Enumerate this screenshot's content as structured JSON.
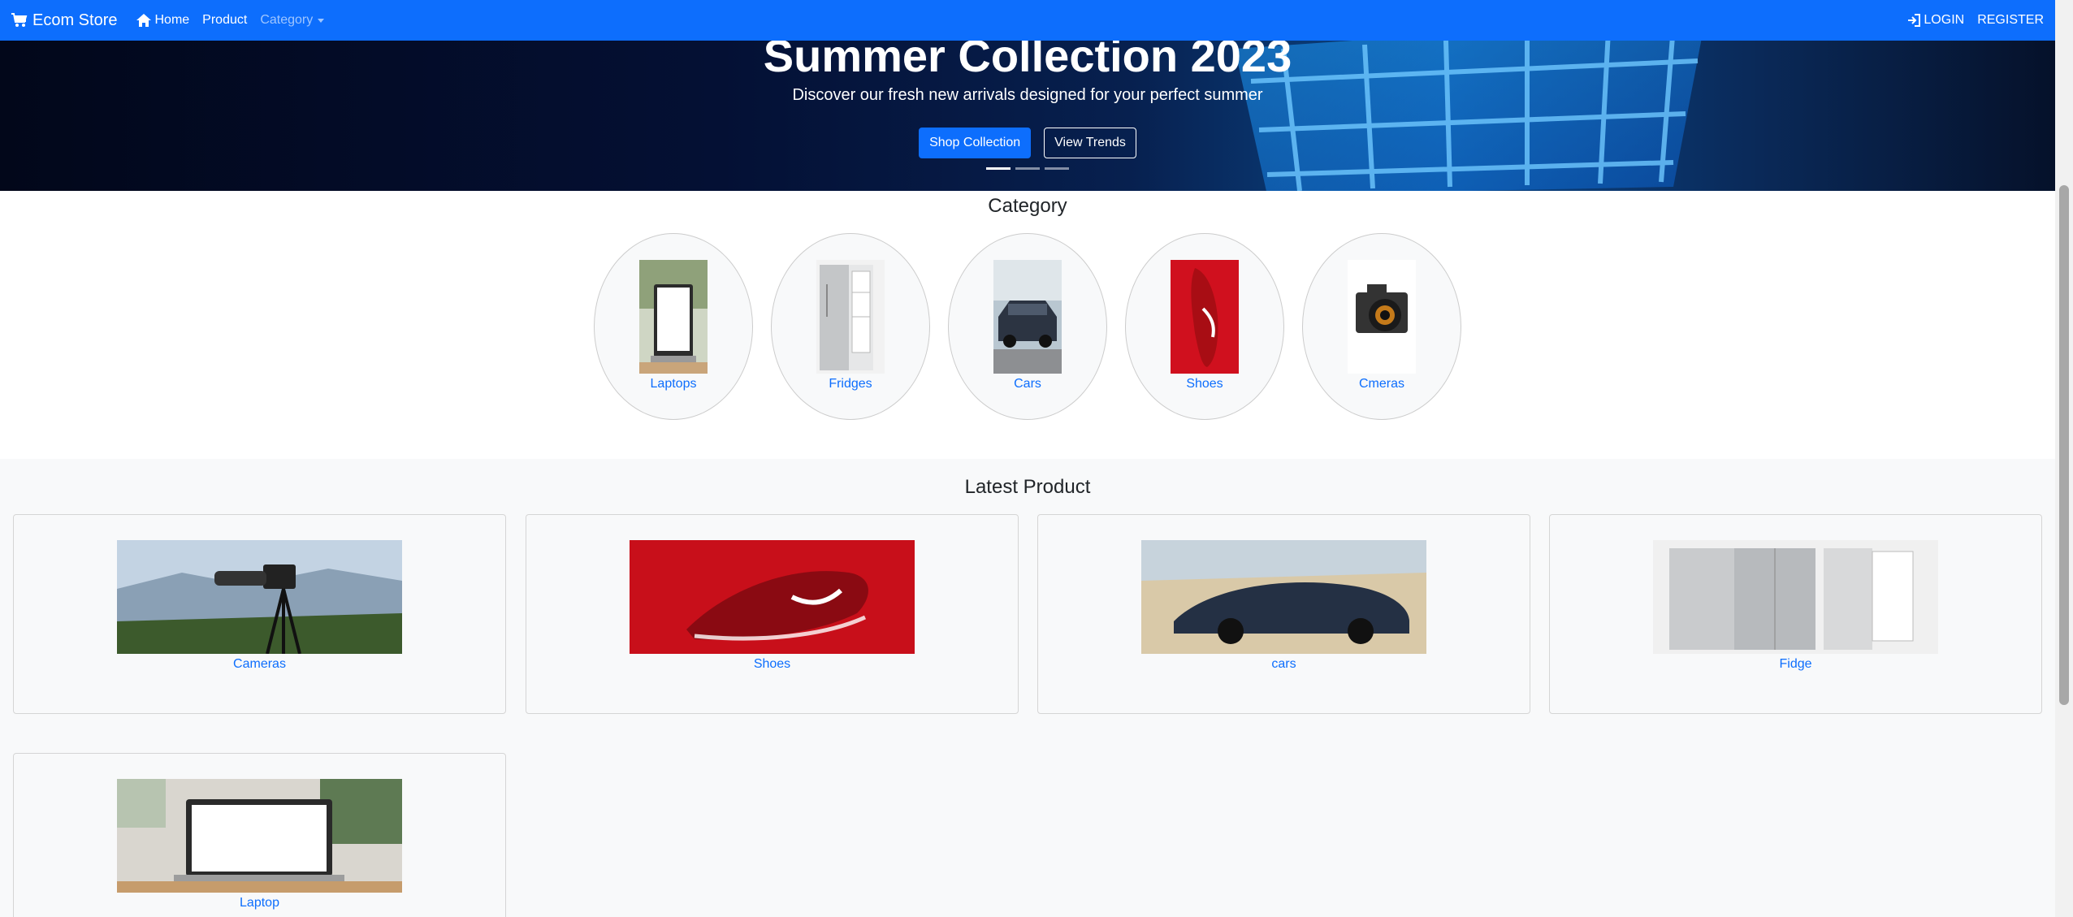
{
  "navbar": {
    "brand": "Ecom Store",
    "home": "Home",
    "product": "Product",
    "category": "Category",
    "login": "LOGIN",
    "register": "REGISTER"
  },
  "hero": {
    "title": "Summer Collection 2023",
    "subtitle": "Discover our fresh new arrivals designed for your perfect summer",
    "primary_button": "Shop Collection",
    "secondary_button": "View Trends"
  },
  "category_section": {
    "title": "Category",
    "items": [
      {
        "label": "Laptops"
      },
      {
        "label": "Fridges"
      },
      {
        "label": "Cars"
      },
      {
        "label": "Shoes"
      },
      {
        "label": "Cmeras"
      }
    ]
  },
  "latest_section": {
    "title": "Latest Product",
    "products": [
      {
        "label": "Cameras"
      },
      {
        "label": "Shoes"
      },
      {
        "label": "cars"
      },
      {
        "label": "Fidge"
      },
      {
        "label": "Laptop"
      }
    ]
  },
  "colors": {
    "primary": "#0d6efd",
    "light_bg": "#f8f9fa"
  }
}
